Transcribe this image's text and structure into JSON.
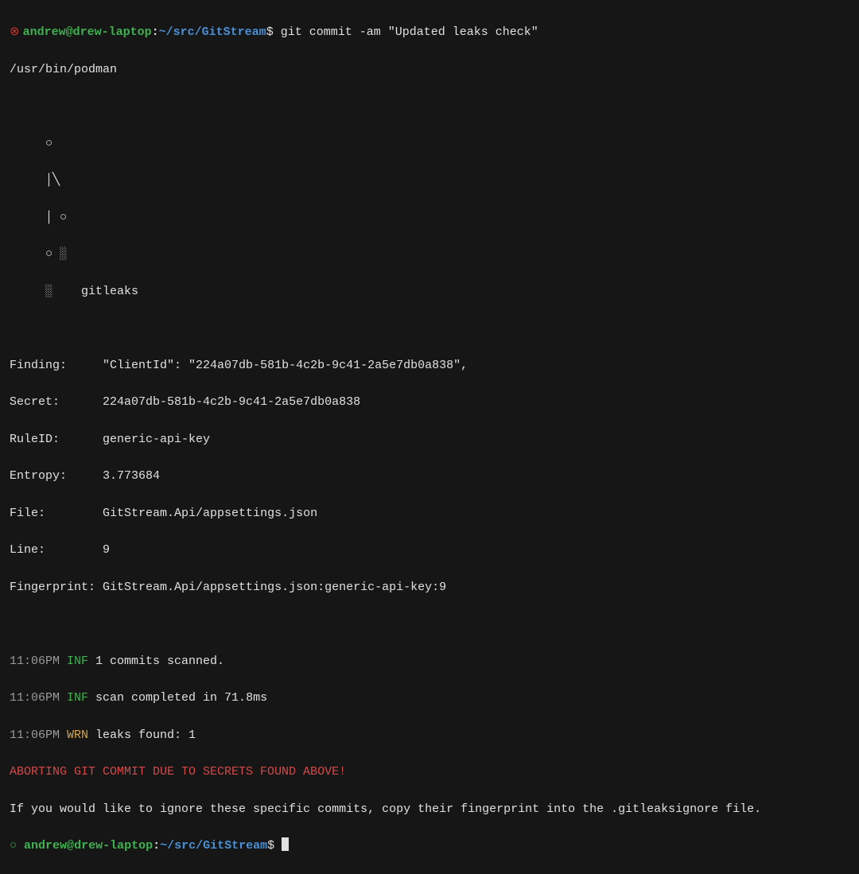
{
  "prompt1": {
    "icon": "⊗",
    "user": "andrew",
    "at": "@",
    "host": "drew-laptop",
    "colon": ":",
    "path": "~/src/GitStream",
    "dollar": "$ ",
    "cmd": "git commit -am \"Updated leaks check\""
  },
  "line_podman": "/usr/bin/podman",
  "art1": "     ○",
  "art2": "     │╲",
  "art3": "     │ ○",
  "art4": "     ○ ░",
  "art5": "     ░    gitleaks",
  "finding_label": "Finding:     ",
  "finding_value": "\"ClientId\": \"224a07db-581b-4c2b-9c41-2a5e7db0a838\",",
  "secret_label": "Secret:      ",
  "secret_value": "224a07db-581b-4c2b-9c41-2a5e7db0a838",
  "ruleid_label": "RuleID:      ",
  "ruleid_value": "generic-api-key",
  "entropy_label": "Entropy:     ",
  "entropy_value": "3.773684",
  "file_label": "File:        ",
  "file_value": "GitStream.Api/appsettings.json",
  "line_label": "Line:        ",
  "line_value": "9",
  "fingerprint_label": "Fingerprint: ",
  "fingerprint_value": "GitStream.Api/appsettings.json:generic-api-key:9",
  "log1_time": "11:06PM ",
  "log1_level": "INF",
  "log1_msg": " 1 commits scanned.",
  "log2_time": "11:06PM ",
  "log2_level": "INF",
  "log2_msg": " scan completed in 71.8ms",
  "log3_time": "11:06PM ",
  "log3_level": "WRN",
  "log3_msg": " leaks found: 1",
  "abort": "ABORTING GIT COMMIT DUE TO SECRETS FOUND ABOVE!",
  "ignore_hint": "If you would like to ignore these specific commits, copy their fingerprint into the .gitleaksignore file.",
  "prompt2": {
    "icon": "○",
    "user": "andrew",
    "at": "@",
    "host": "drew-laptop",
    "colon": ":",
    "path": "~/src/GitStream",
    "dollar": "$ "
  }
}
